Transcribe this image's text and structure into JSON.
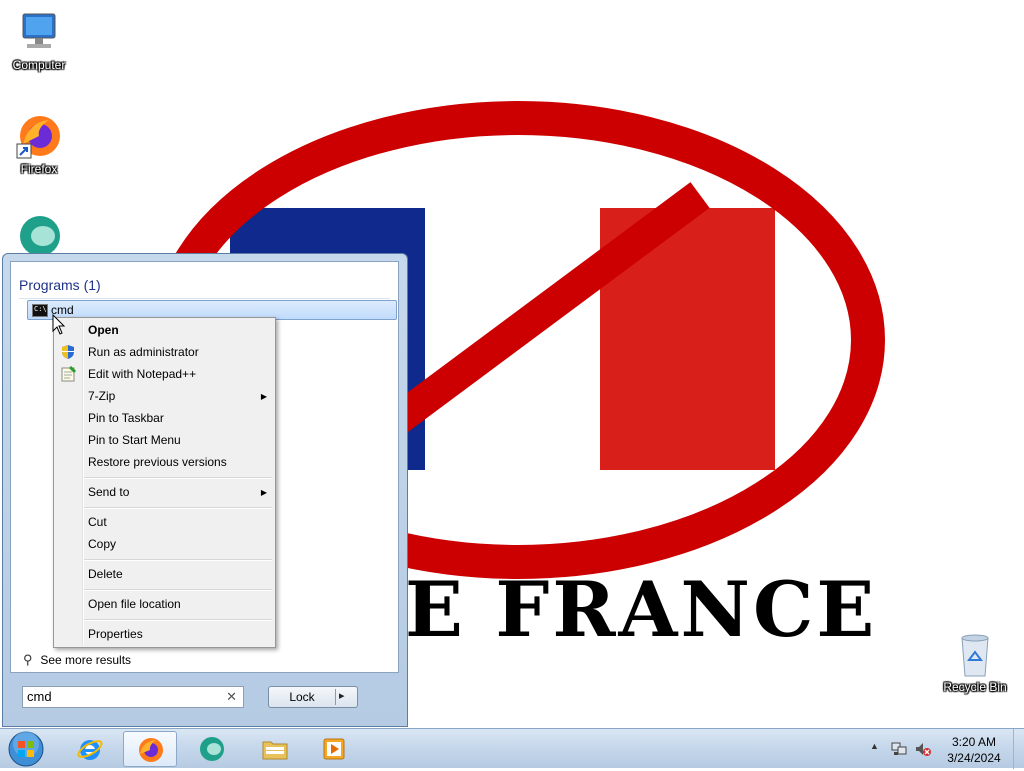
{
  "desktop": {
    "icons": [
      {
        "label": "Computer",
        "icon": "computer-icon"
      },
      {
        "label": "Firefox",
        "icon": "firefox-icon"
      },
      {
        "label": "",
        "icon": "app-icon"
      },
      {
        "label": "Recycle Bin",
        "icon": "recycle-bin-icon"
      }
    ],
    "wallpaper_text": "E FRANCE",
    "colors": {
      "ring": "#cc0000",
      "flag_blue": "#0f2a8c",
      "flag_red": "#d91f1a"
    }
  },
  "start_menu": {
    "programs_header": "Programs (1)",
    "results": [
      {
        "label": "cmd",
        "icon": "cmd-icon"
      }
    ],
    "see_more": "See more results",
    "search": {
      "value": "cmd",
      "clear_icon": "clear-icon"
    },
    "power_button": {
      "label": "Lock",
      "arrow": "▸"
    }
  },
  "context_menu": {
    "items": [
      {
        "label": "Open",
        "bold": true
      },
      {
        "label": "Run as administrator",
        "icon": "uac-shield-icon"
      },
      {
        "label": "Edit with Notepad++",
        "icon": "notepad-plus-plus-icon"
      },
      {
        "label": "7-Zip",
        "submenu": true
      },
      {
        "label": "Pin to Taskbar"
      },
      {
        "label": "Pin to Start Menu"
      },
      {
        "label": "Restore previous versions"
      },
      {
        "label": "Send to",
        "submenu": true
      },
      {
        "label": "Cut"
      },
      {
        "label": "Copy"
      },
      {
        "label": "Delete"
      },
      {
        "label": "Open file location"
      },
      {
        "label": "Properties"
      }
    ]
  },
  "taskbar": {
    "buttons": [
      {
        "name": "internet-explorer",
        "icon": "ie-icon"
      },
      {
        "name": "firefox",
        "icon": "firefox-icon",
        "active": true
      },
      {
        "name": "app",
        "icon": "app-icon"
      },
      {
        "name": "windows-explorer",
        "icon": "folder-icon"
      },
      {
        "name": "media-player",
        "icon": "media-player-icon"
      }
    ],
    "tray": {
      "time": "3:20 AM",
      "date": "3/24/2024",
      "show_hidden": "▲"
    }
  }
}
